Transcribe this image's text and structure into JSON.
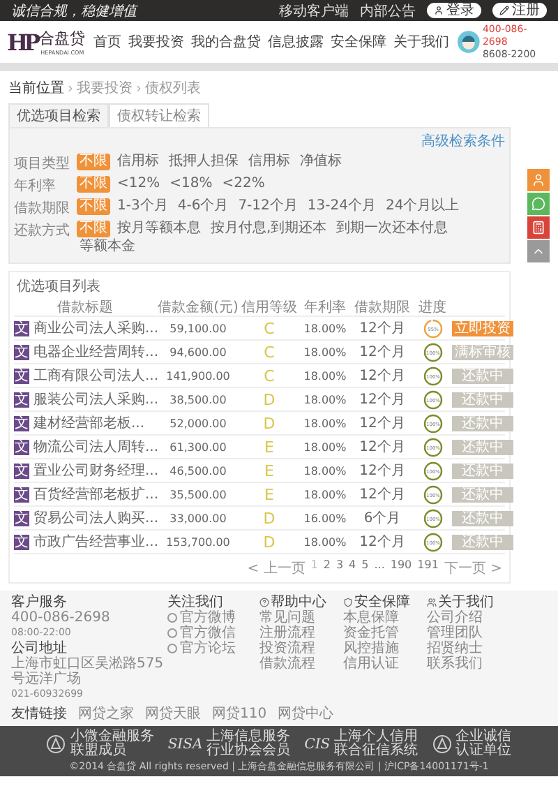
{
  "top_bar": {
    "slogan": "诚信合规，稳健增值",
    "links": [
      "移动客户端",
      "内部公告"
    ],
    "login": "登录",
    "register": "注册"
  },
  "header": {
    "logo_mark": "HP",
    "logo_name": "合盘贷",
    "logo_domain": "HEPANDAI.COM",
    "nav": [
      "首页",
      "我要投资",
      "我的合盘贷",
      "信息披露",
      "安全保障",
      "关于我们"
    ],
    "hotline": "400-086-2698",
    "hours": "8608-2200"
  },
  "breadcrumb": [
    "当前位置",
    "我要投资",
    "债权列表"
  ],
  "tabs": [
    {
      "label": "优选项目检索",
      "selected": true
    },
    {
      "label": "债权转让检索",
      "selected": false
    }
  ],
  "advanced_link": "高级检索条件",
  "filters": [
    {
      "label": "项目类型",
      "options": [
        {
          "label": "不限",
          "selected": true
        },
        {
          "label": "信用标",
          "selected": false
        },
        {
          "label": "抵押人担保",
          "selected": false
        },
        {
          "label": "信用标",
          "selected": false
        },
        {
          "label": "净值标",
          "selected": false
        }
      ]
    },
    {
      "label": "年利率",
      "options": [
        {
          "label": "不限",
          "selected": true
        },
        {
          "label": "<12%",
          "selected": false
        },
        {
          "label": "<18%",
          "selected": false
        },
        {
          "label": "<22%",
          "selected": false
        }
      ]
    },
    {
      "label": "借款期限",
      "options": [
        {
          "label": "不限",
          "selected": true
        },
        {
          "label": "1-3个月",
          "selected": false
        },
        {
          "label": "4-6个月",
          "selected": false
        },
        {
          "label": "7-12个月",
          "selected": false
        },
        {
          "label": "13-24个月",
          "selected": false
        },
        {
          "label": "24个月以上",
          "selected": false
        }
      ]
    },
    {
      "label": "还款方式",
      "options": [
        {
          "label": "不限",
          "selected": true
        },
        {
          "label": "按月等额本息",
          "selected": false
        },
        {
          "label": "按月付息,到期还本",
          "selected": false
        },
        {
          "label": "到期一次还本付息",
          "selected": false
        },
        {
          "label": "等额本金",
          "selected": false
        }
      ]
    }
  ],
  "list_title": "优选项目列表",
  "columns": [
    "借款标题",
    "借款金额(元)",
    "信用等级",
    "年利率",
    "借款期限",
    "进度"
  ],
  "rows": [
    {
      "badge": "文",
      "title": "商业公司法人采购...",
      "amount": "59,100.00",
      "grade": "C",
      "rate": "18.00%",
      "term": "12个月",
      "progress": "95%",
      "level": 0.95,
      "action": {
        "kind": "invest",
        "label": "立即投资"
      }
    },
    {
      "badge": "文",
      "title": "电器企业经营周转...",
      "amount": "94,600.00",
      "grade": "C",
      "rate": "18.00%",
      "term": "12个月",
      "progress": "100%",
      "level": 1,
      "action": {
        "kind": "closed",
        "label": "满标审核"
      }
    },
    {
      "badge": "文",
      "title": "工商有限公司法人...",
      "amount": "141,900.00",
      "grade": "C",
      "rate": "18.00%",
      "term": "12个月",
      "progress": "100%",
      "level": 1,
      "action": {
        "kind": "closed",
        "label": "还款中"
      }
    },
    {
      "badge": "文",
      "title": "服装公司法人采购...",
      "amount": "38,500.00",
      "grade": "D",
      "rate": "18.00%",
      "term": "12个月",
      "progress": "100%",
      "level": 1,
      "action": {
        "kind": "closed",
        "label": "还款中"
      }
    },
    {
      "badge": "文",
      "title": "建材经营部老板...",
      "amount": "52,000.00",
      "grade": "D",
      "rate": "18.00%",
      "term": "12个月",
      "progress": "100%",
      "level": 1,
      "action": {
        "kind": "closed",
        "label": "还款中"
      }
    },
    {
      "badge": "文",
      "title": "物流公司法人周转...",
      "amount": "61,300.00",
      "grade": "E",
      "rate": "18.00%",
      "term": "12个月",
      "progress": "100%",
      "level": 1,
      "action": {
        "kind": "closed",
        "label": "还款中"
      }
    },
    {
      "badge": "文",
      "title": "置业公司财务经理...",
      "amount": "46,500.00",
      "grade": "E",
      "rate": "18.00%",
      "term": "12个月",
      "progress": "100%",
      "level": 1,
      "action": {
        "kind": "closed",
        "label": "还款中"
      }
    },
    {
      "badge": "文",
      "title": "百货经营部老板扩...",
      "amount": "35,500.00",
      "grade": "E",
      "rate": "18.00%",
      "term": "12个月",
      "progress": "100%",
      "level": 1,
      "action": {
        "kind": "closed",
        "label": "还款中"
      }
    },
    {
      "badge": "文",
      "title": "贸易公司法人购买...",
      "amount": "33,000.00",
      "grade": "D",
      "rate": "16.00%",
      "term": "6个月",
      "progress": "100%",
      "level": 1,
      "action": {
        "kind": "closed",
        "label": "还款中"
      }
    },
    {
      "badge": "文",
      "title": "市政广告经营事业...",
      "amount": "153,700.00",
      "grade": "D",
      "rate": "18.00%",
      "term": "12个月",
      "progress": "100%",
      "level": 1,
      "action": {
        "kind": "closed",
        "label": "还款中"
      }
    }
  ],
  "pagination": {
    "prev": "< 上一页",
    "pages": [
      {
        "label": "1",
        "selected": true
      },
      {
        "label": "2",
        "selected": false
      },
      {
        "label": "3",
        "selected": false
      },
      {
        "label": "4",
        "selected": false
      },
      {
        "label": "5",
        "selected": false
      },
      {
        "label": "...",
        "selected": false
      },
      {
        "label": "190",
        "selected": false
      },
      {
        "label": "191",
        "selected": false
      }
    ],
    "next": "下一页 >"
  },
  "footer": {
    "service_title": "客户服务",
    "service_phone": "400-086-2698",
    "service_hours": "08:00-22:00",
    "address_title": "公司地址",
    "address": "上海市虹口区吴淞路575号远洋广场",
    "address_phone": "021-60932699",
    "columns": [
      {
        "title": "关注我们",
        "kind": "social",
        "items": [
          "官方微博",
          "官方微信",
          "官方论坛"
        ]
      },
      {
        "title": "帮助中心",
        "kind": "links",
        "items": [
          "常见问题",
          "注册流程",
          "投资流程",
          "借款流程"
        ]
      },
      {
        "title": "安全保障",
        "kind": "links",
        "items": [
          "本息保障",
          "资金托管",
          "风控措施",
          "信用认证"
        ]
      },
      {
        "title": "关于我们",
        "kind": "links",
        "items": [
          "公司介绍",
          "管理团队",
          "招贤纳士",
          "联系我们"
        ]
      }
    ],
    "friend_links": [
      "友情链接",
      "网贷之家",
      "网贷天眼",
      "网贷110",
      "网贷中心"
    ],
    "badges": [
      {
        "line1": "小微金融服务",
        "line2": "联盟成员"
      },
      {
        "mark": "SISA",
        "line1": "上海信息服务",
        "line2": "行业协会会员"
      },
      {
        "mark": "CIS",
        "line1": "上海个人信用",
        "line2": "联合征信系统"
      },
      {
        "line1": "企业诚信",
        "line2": "认证单位"
      }
    ],
    "copyright": "©2014 合盘贷 All rights reserved | 上海合盘金融信息服务有限公司 | 沪ICP备14001171号-1"
  }
}
